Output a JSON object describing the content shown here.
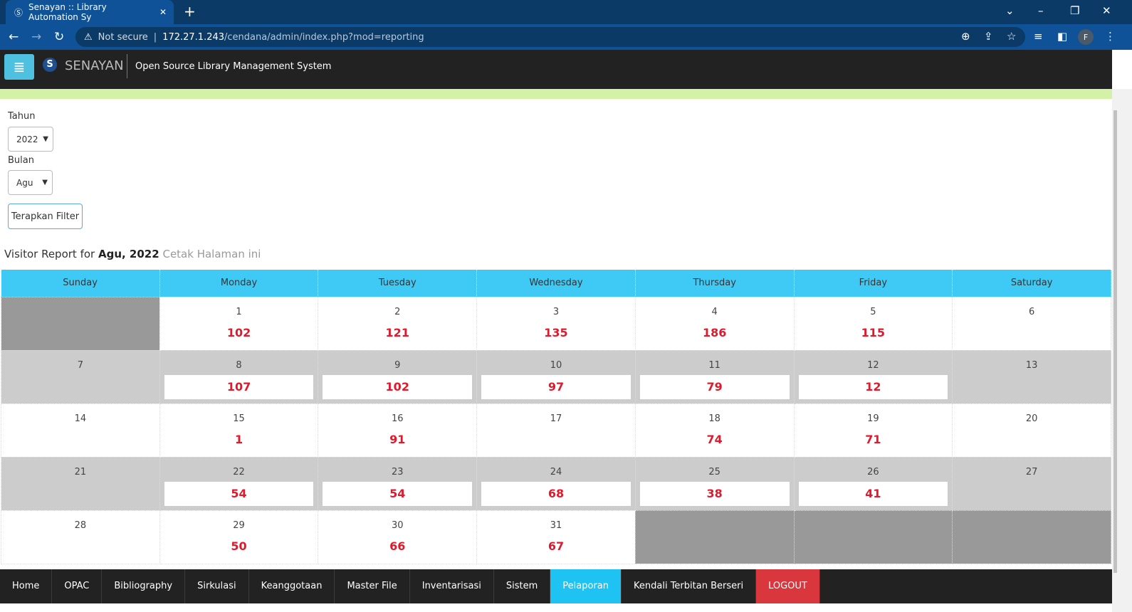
{
  "browser": {
    "tab_title": "Senayan :: Library Automation Sy",
    "not_secure": "Not secure",
    "url_host": "172.27.1.243",
    "url_path": "/cendana/admin/index.php?mod=reporting",
    "profile": "F"
  },
  "header": {
    "brand": "SENAYAN",
    "tagline": "Open Source Library Management System"
  },
  "filter": {
    "year_label": "Tahun",
    "year_value": "2022",
    "month_label": "Bulan",
    "month_value": "Agu",
    "apply_label": "Terapkan Filter"
  },
  "report": {
    "prefix": "Visitor Report for",
    "period": "Agu, 2022",
    "print_link": "Cetak Halaman ini"
  },
  "calendar": {
    "days": [
      "Sunday",
      "Monday",
      "Tuesday",
      "Wednesday",
      "Thursday",
      "Friday",
      "Saturday"
    ],
    "weeks": [
      [
        null,
        {
          "day": "1",
          "count": "102"
        },
        {
          "day": "2",
          "count": "121"
        },
        {
          "day": "3",
          "count": "135"
        },
        {
          "day": "4",
          "count": "186"
        },
        {
          "day": "5",
          "count": "115"
        },
        {
          "day": "6",
          "count": ""
        }
      ],
      [
        {
          "day": "7",
          "count": ""
        },
        {
          "day": "8",
          "count": "107"
        },
        {
          "day": "9",
          "count": "102"
        },
        {
          "day": "10",
          "count": "97"
        },
        {
          "day": "11",
          "count": "79"
        },
        {
          "day": "12",
          "count": "12"
        },
        {
          "day": "13",
          "count": ""
        }
      ],
      [
        {
          "day": "14",
          "count": ""
        },
        {
          "day": "15",
          "count": "1"
        },
        {
          "day": "16",
          "count": "91"
        },
        {
          "day": "17",
          "count": ""
        },
        {
          "day": "18",
          "count": "74"
        },
        {
          "day": "19",
          "count": "71"
        },
        {
          "day": "20",
          "count": ""
        }
      ],
      [
        {
          "day": "21",
          "count": ""
        },
        {
          "day": "22",
          "count": "54"
        },
        {
          "day": "23",
          "count": "54"
        },
        {
          "day": "24",
          "count": "68"
        },
        {
          "day": "25",
          "count": "38"
        },
        {
          "day": "26",
          "count": "41"
        },
        {
          "day": "27",
          "count": ""
        }
      ],
      [
        {
          "day": "28",
          "count": ""
        },
        {
          "day": "29",
          "count": "50"
        },
        {
          "day": "30",
          "count": "66"
        },
        {
          "day": "31",
          "count": "67"
        },
        null,
        null,
        null
      ]
    ]
  },
  "bottom_nav": [
    "Home",
    "OPAC",
    "Bibliography",
    "Sirkulasi",
    "Keanggotaan",
    "Master File",
    "Inventarisasi",
    "Sistem",
    "Pelaporan",
    "Kendali Terbitan Berseri",
    "LOGOUT"
  ],
  "bottom_active": "Pelaporan",
  "colors": {
    "accent": "#3fcaf5",
    "count": "#e0192c",
    "logout": "#d9363e"
  }
}
